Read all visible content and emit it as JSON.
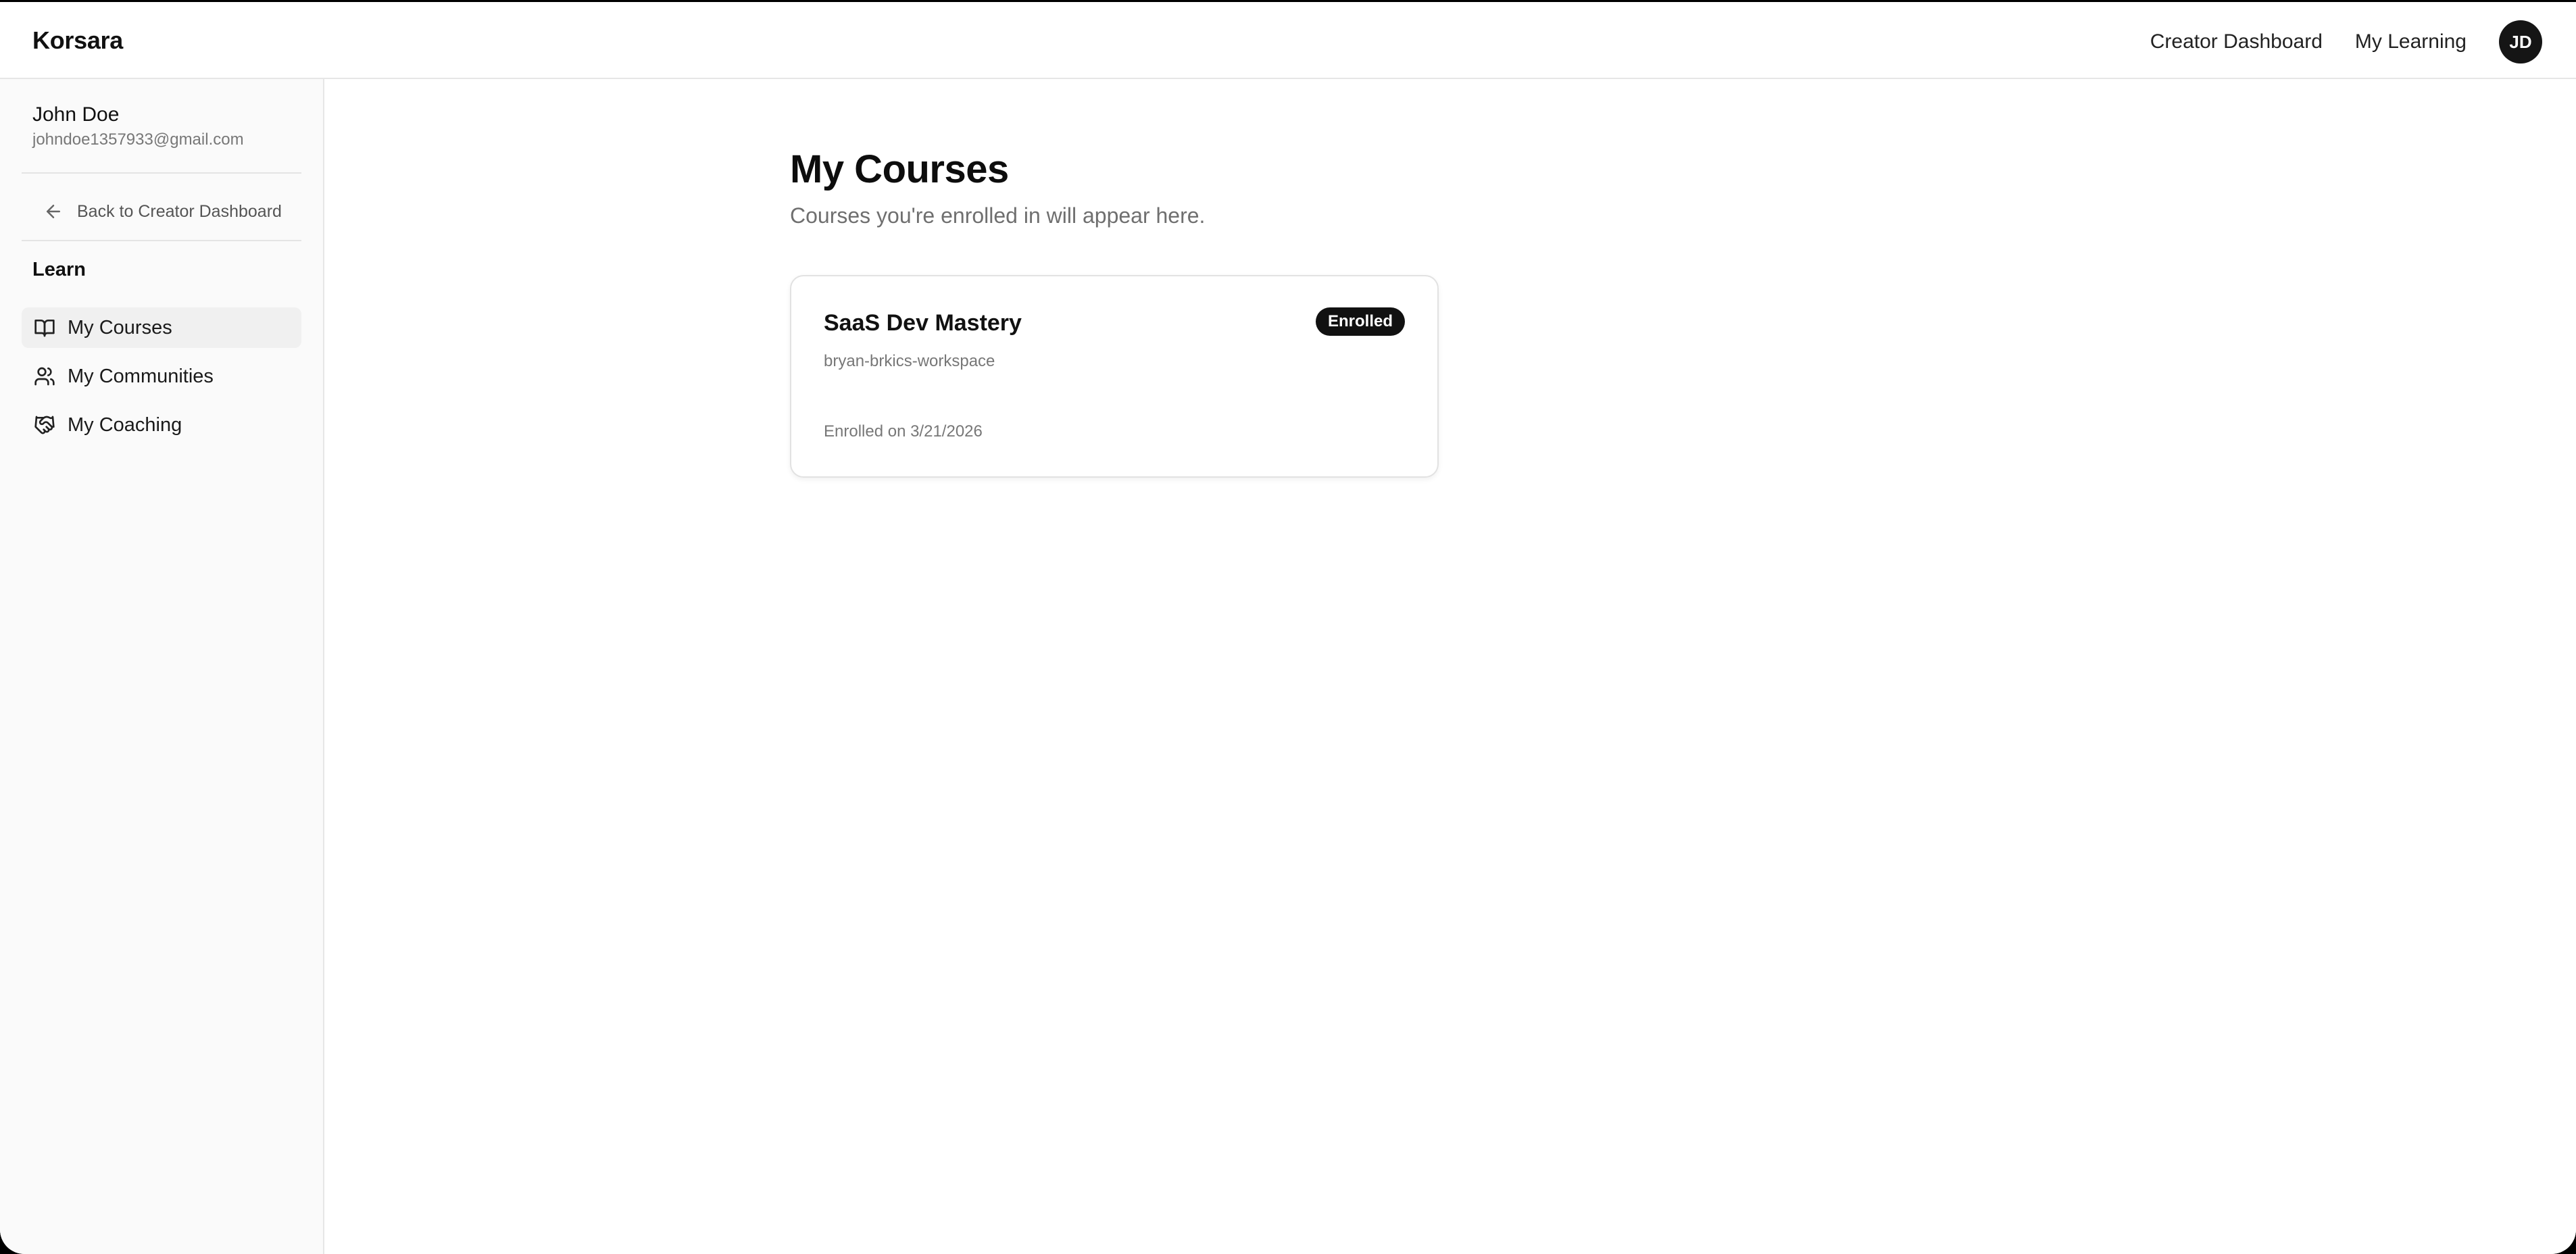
{
  "app": {
    "brand": "Korsara"
  },
  "topnav": {
    "creator_dashboard": "Creator Dashboard",
    "my_learning": "My Learning",
    "avatar_initials": "JD"
  },
  "sidebar": {
    "user_name": "John Doe",
    "user_email": "johndoe1357933@gmail.com",
    "back_label": "Back to Creator Dashboard",
    "section_label": "Learn",
    "items": [
      {
        "label": "My Courses",
        "icon": "book-open-icon",
        "active": true
      },
      {
        "label": "My Communities",
        "icon": "users-icon",
        "active": false
      },
      {
        "label": "My Coaching",
        "icon": "handshake-icon",
        "active": false
      }
    ]
  },
  "main": {
    "title": "My Courses",
    "subtitle": "Courses you're enrolled in will appear here.",
    "courses": [
      {
        "title": "SaaS Dev Mastery",
        "workspace": "bryan-brkics-workspace",
        "badge": "Enrolled",
        "enrolled_text": "Enrolled on 3/21/2026"
      }
    ]
  },
  "colors": {
    "sidebar_bg": "#fafafa",
    "active_item_bg": "#f0f0f0",
    "badge_bg": "#111111",
    "avatar_bg": "#151515",
    "muted_text": "#777777"
  }
}
